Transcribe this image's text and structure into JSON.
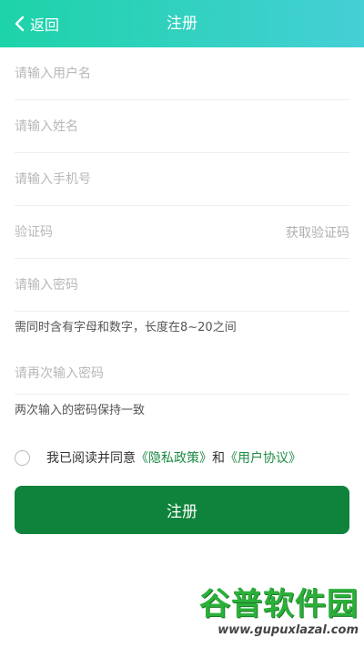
{
  "header": {
    "back_label": "返回",
    "title": "注册",
    "gradient_start": "#1dd3a8",
    "gradient_end": "#45cfd6"
  },
  "form": {
    "username_placeholder": "请输入用户名",
    "name_placeholder": "请输入姓名",
    "phone_placeholder": "请输入手机号",
    "code_placeholder": "验证码",
    "get_code_label": "获取验证码",
    "password_placeholder": "请输入密码",
    "password_hint": "需同时含有字母和数字，长度在8~20之间",
    "confirm_placeholder": "请再次输入密码",
    "confirm_hint": "两次输入的密码保持一致"
  },
  "agreement": {
    "prefix": "我已阅读并同意",
    "privacy_link": "《隐私政策》",
    "and": "和",
    "terms_link": "《用户协议》",
    "link_color": "#1e8a44"
  },
  "submit": {
    "label": "注册",
    "color": "#0f833b"
  },
  "watermark": {
    "logo": "谷普软件园",
    "url": "www.gupuxlazal.com"
  }
}
